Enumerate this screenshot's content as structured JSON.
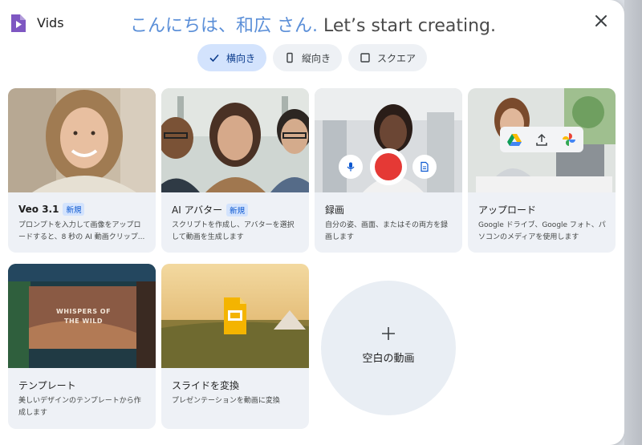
{
  "header": {
    "app_name": "Vids",
    "greeting_name": "こんにちは、和広 さん.",
    "greeting_tail": " Let’s start creating."
  },
  "orientation": {
    "options": [
      {
        "label": "横向き",
        "selected": true
      },
      {
        "label": "縦向き",
        "selected": false
      },
      {
        "label": "スクエア",
        "selected": false
      }
    ]
  },
  "cards": {
    "veo": {
      "title": "Veo 3.1",
      "badge": "新規",
      "desc": "プロンプトを入力して画像をアップロードすると、8 秒の AI 動画クリップ..."
    },
    "avatar": {
      "title": "AI アバター",
      "badge": "新規",
      "desc": "スクリプトを作成し、アバターを選択して動画を生成します"
    },
    "record": {
      "title": "録画",
      "desc": "自分の姿、画面、またはその両方を録画します"
    },
    "upload": {
      "title": "アップロード",
      "desc": "Google ドライブ、Google フォト、パソコンのメディアを使用します"
    },
    "template": {
      "title": "テンプレート",
      "desc": "美しいデザインのテンプレートから作成します",
      "thumb_text": "WHISPERS OF THE WILD"
    },
    "slides": {
      "title": "スライドを変換",
      "desc": "プレゼンテーションを動画に変換"
    }
  },
  "blank": {
    "label": "空白の動画"
  },
  "colors": {
    "accent": "#0b57d0",
    "chip_active": "#d3e3fd",
    "card_bg": "#eef1f6",
    "record_red": "#e53935"
  }
}
